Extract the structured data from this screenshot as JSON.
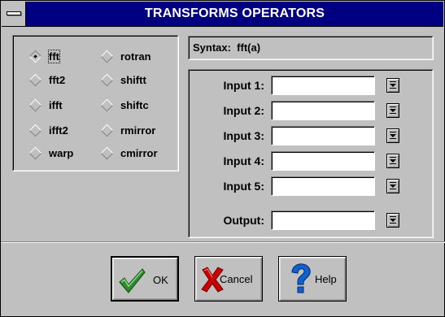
{
  "window": {
    "title": "TRANSFORMS OPERATORS"
  },
  "operators": {
    "selected": "fft",
    "left_column": [
      "fft",
      "fft2",
      "ifft",
      "ifft2",
      "warp"
    ],
    "right_column": [
      "rotran",
      "shiftt",
      "shiftc",
      "rmirror",
      "cmirror"
    ]
  },
  "syntax": {
    "text": "Syntax:  fft(a)"
  },
  "inputs": [
    {
      "label": "Input 1:",
      "value": ""
    },
    {
      "label": "Input 2:",
      "value": ""
    },
    {
      "label": "Input 3:",
      "value": ""
    },
    {
      "label": "Input 4:",
      "value": ""
    },
    {
      "label": "Input 5:",
      "value": ""
    }
  ],
  "output": {
    "label": "Output:",
    "value": ""
  },
  "buttons": {
    "ok": "OK",
    "cancel": "Cancel",
    "help": "Help"
  },
  "colors": {
    "titlebar": "#000080",
    "face": "#c0c0c0",
    "ok_check": "#2e8b2e",
    "cancel_x": "#cc0000",
    "help_q": "#1060d0"
  }
}
